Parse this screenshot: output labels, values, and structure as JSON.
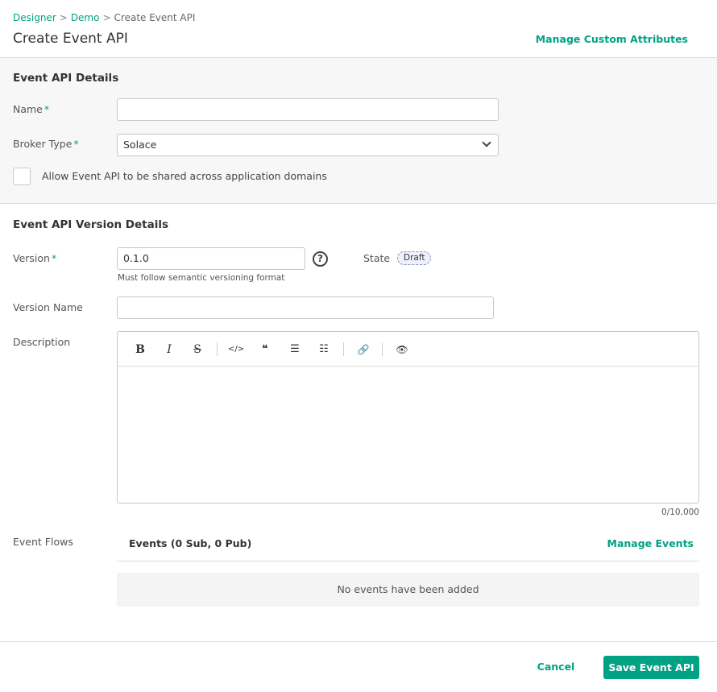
{
  "breadcrumb": {
    "items": [
      "Designer",
      "Demo",
      "Create Event API"
    ],
    "separator": ">"
  },
  "page": {
    "title": "Create Event API",
    "manage_attributes_label": "Manage Custom Attributes"
  },
  "event_api_details": {
    "title": "Event API Details",
    "name": {
      "label": "Name",
      "required_mark": "*",
      "value": ""
    },
    "broker_type": {
      "label": "Broker Type",
      "required_mark": "*",
      "value": "Solace"
    },
    "shared": {
      "label": "Allow Event API to be shared across application domains",
      "checked": false
    }
  },
  "version_details": {
    "title": "Event API Version Details",
    "version": {
      "label": "Version",
      "required_mark": "*",
      "value": "0.1.0",
      "hint": "Must follow semantic versioning format",
      "help_glyph": "?"
    },
    "state": {
      "label": "State",
      "value": "Draft"
    },
    "version_name": {
      "label": "Version Name",
      "value": ""
    },
    "description": {
      "label": "Description",
      "value": "",
      "counter": "0/10,000",
      "toolbar": {
        "bold": "B",
        "italic": "I",
        "strike": "S",
        "code": "</>",
        "quote": "❝",
        "bullet_list": "☰",
        "numbered_list": "☷",
        "link": "🔗",
        "preview": "👁"
      }
    },
    "event_flows": {
      "label": "Event Flows",
      "header": "Events (0 Sub, 0 Pub)",
      "manage_label": "Manage Events",
      "empty_message": "No events have been added"
    }
  },
  "footer": {
    "cancel_label": "Cancel",
    "save_label": "Save Event API"
  },
  "colors": {
    "accent": "#00a283",
    "section_bg": "#f7f7f7",
    "border": "#dcdcdc",
    "draft_badge": "#eef0fb"
  }
}
